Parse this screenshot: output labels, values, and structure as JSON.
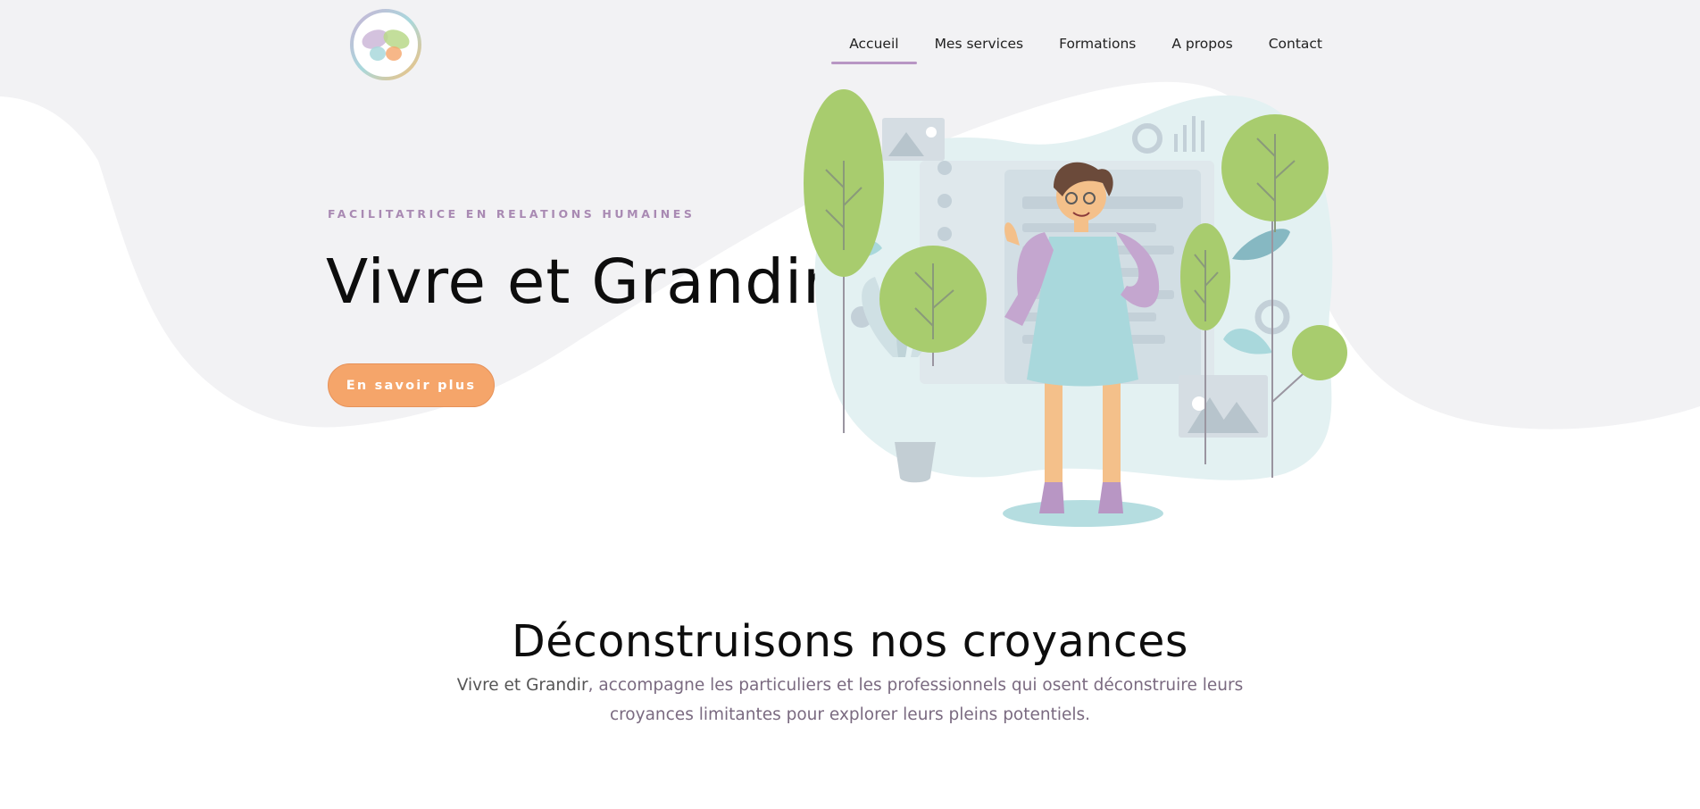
{
  "brand": {
    "logo_icon": "butterfly-logo-icon",
    "colors": {
      "accent": "#b896c4",
      "cta": "#f5a56a",
      "leaf": "#a8cc6e",
      "teal": "#a9d8dc"
    }
  },
  "nav": {
    "items": [
      {
        "label": "Accueil",
        "active": true
      },
      {
        "label": "Mes services",
        "active": false
      },
      {
        "label": "Formations",
        "active": false
      },
      {
        "label": "A propos",
        "active": false
      },
      {
        "label": "Contact",
        "active": false
      }
    ]
  },
  "hero": {
    "eyebrow": "FACILITATRICE EN RELATIONS HUMAINES",
    "title": "Vivre et Grandir",
    "cta_label": "En savoir plus",
    "illustration": "woman-waving-with-trees-illustration"
  },
  "intro": {
    "title": "Déconstruisons nos croyances",
    "brand_name": "Vivre et Grandir",
    "text": ", accompagne les particuliers et les professionnels qui osent déconstruire leurs croyances limitantes pour explorer leurs pleins potentiels."
  }
}
